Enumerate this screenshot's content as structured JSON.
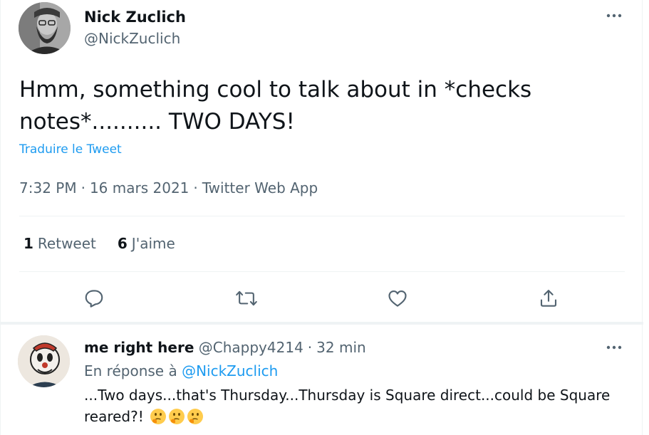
{
  "tweet": {
    "author": {
      "name": "Nick Zuclich",
      "handle": "@NickZuclich"
    },
    "text": "Hmm, something cool to talk about in *checks notes*.......... TWO DAYS!",
    "translate_label": "Traduire le Tweet",
    "time": "7:32 PM",
    "date": "16 mars 2021",
    "source": "Twitter Web App",
    "meta_separator": "·",
    "stats": {
      "retweets_count": "1",
      "retweets_label": "Retweet",
      "likes_count": "6",
      "likes_label": "J'aime"
    },
    "actions": [
      "reply-icon",
      "retweet-icon",
      "like-icon",
      "share-icon"
    ]
  },
  "reply": {
    "name": "me right here",
    "handle": "@Chappy4214",
    "separator": "·",
    "time": "32 min",
    "reply_prefix": "En réponse à",
    "reply_mention": "@NickZuclich",
    "text": "...Two days...that's Thursday...Thursday is Square direct...could be Square reared?!",
    "emojis": [
      "thinking-face-emoji",
      "thinking-face-emoji",
      "thinking-face-emoji"
    ]
  },
  "colors": {
    "accent": "#1d9bf0",
    "secondary_text": "#536471",
    "primary_text": "#0f1419",
    "divider": "#eff3f4"
  }
}
